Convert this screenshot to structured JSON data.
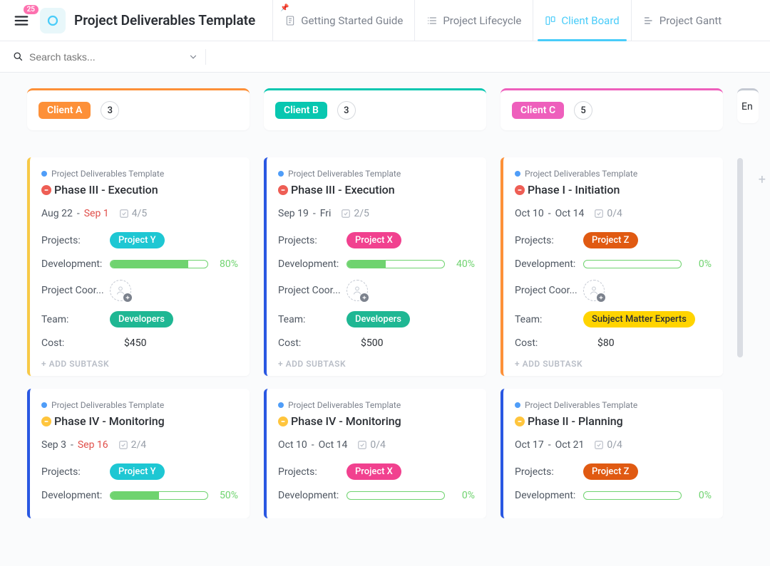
{
  "header": {
    "menu_badge": "25",
    "title": "Project Deliverables Template",
    "tabs": [
      {
        "icon": "doc",
        "label": "Getting Started Guide",
        "active": false,
        "pinned": true
      },
      {
        "icon": "list",
        "label": "Project Lifecycle",
        "active": false,
        "pinned": false
      },
      {
        "icon": "board",
        "label": "Client Board",
        "active": true,
        "pinned": false
      },
      {
        "icon": "gantt",
        "label": "Project Gantt",
        "active": false,
        "pinned": false
      }
    ]
  },
  "search": {
    "placeholder": "Search tasks..."
  },
  "columns": [
    {
      "label": "Client A",
      "count": "3",
      "color": "#fd9038",
      "badge_bg": "#fd9038"
    },
    {
      "label": "Client B",
      "count": "3",
      "color": "#08c7b0",
      "badge_bg": "#08c7b0"
    },
    {
      "label": "Client C",
      "count": "5",
      "color": "#ee5fbc",
      "badge_bg": "#ee5fbc"
    }
  ],
  "peek_col_label": "En",
  "cards_col0": [
    {
      "template": "Project Deliverables Template",
      "priority": "red",
      "title": "Phase III - Execution",
      "border": "#f7c947",
      "date_start": "Aug 22",
      "date_end": "Sep 1",
      "date_end_red": true,
      "checks": "4/5",
      "project_label": "Projects:",
      "project_pill": "Project Y",
      "project_pill_bg": "#1ec7d3",
      "dev_label": "Development:",
      "dev_pct": 80,
      "dev_text": "80%",
      "coord_label": "Project Coor...",
      "team_label": "Team:",
      "team_pill": "Developers",
      "team_pill_bg": "#1fb793",
      "cost_label": "Cost:",
      "cost_value": "$450",
      "add_subtask": "+ ADD SUBTASK"
    },
    {
      "template": "Project Deliverables Template",
      "priority": "yellow",
      "title": "Phase IV - Monitoring",
      "border": "#2957e2",
      "date_start": "Sep 3",
      "date_end": "Sep 16",
      "date_end_red": true,
      "checks": "2/4",
      "project_label": "Projects:",
      "project_pill": "Project Y",
      "project_pill_bg": "#1ec7d3",
      "dev_label": "Development:",
      "dev_pct": 50,
      "dev_text": "50%"
    }
  ],
  "cards_col1": [
    {
      "template": "Project Deliverables Template",
      "priority": "red",
      "title": "Phase III - Execution",
      "border": "#2957e2",
      "date_start": "Sep 19",
      "date_end": "Fri",
      "date_end_red": false,
      "checks": "2/5",
      "project_label": "Projects:",
      "project_pill": "Project X",
      "project_pill_bg": "#f1418f",
      "dev_label": "Development:",
      "dev_pct": 40,
      "dev_text": "40%",
      "coord_label": "Project Coor...",
      "team_label": "Team:",
      "team_pill": "Developers",
      "team_pill_bg": "#1fb793",
      "cost_label": "Cost:",
      "cost_value": "$500",
      "add_subtask": "+ ADD SUBTASK"
    },
    {
      "template": "Project Deliverables Template",
      "priority": "yellow",
      "title": "Phase IV - Monitoring",
      "border": "#2957e2",
      "date_start": "Oct 10",
      "date_end": "Oct 14",
      "date_end_red": false,
      "checks": "0/4",
      "project_label": "Projects:",
      "project_pill": "Project X",
      "project_pill_bg": "#f1418f",
      "dev_label": "Development:",
      "dev_pct": 0,
      "dev_text": "0%"
    }
  ],
  "cards_col2": [
    {
      "template": "Project Deliverables Template",
      "priority": "red",
      "title": "Phase I - Initiation",
      "border": "#fd9038",
      "date_start": "Oct 10",
      "date_end": "Oct 14",
      "date_end_red": false,
      "checks": "0/4",
      "project_label": "Projects:",
      "project_pill": "Project Z",
      "project_pill_bg": "#e05a12",
      "dev_label": "Development:",
      "dev_pct": 0,
      "dev_text": "0%",
      "coord_label": "Project Coor...",
      "team_label": "Team:",
      "team_pill": "Subject Matter Experts",
      "team_pill_bg": "#ffd400",
      "team_text_dark": true,
      "cost_label": "Cost:",
      "cost_value": "$80",
      "add_subtask": "+ ADD SUBTASK"
    },
    {
      "template": "Project Deliverables Template",
      "priority": "yellow",
      "title": "Phase II - Planning",
      "border": "#2957e2",
      "date_start": "Oct 17",
      "date_end": "Oct 21",
      "date_end_red": false,
      "checks": "0/4",
      "project_label": "Projects:",
      "project_pill": "Project Z",
      "project_pill_bg": "#e05a12",
      "dev_label": "Development:",
      "dev_pct": 0,
      "dev_text": "0%"
    }
  ]
}
